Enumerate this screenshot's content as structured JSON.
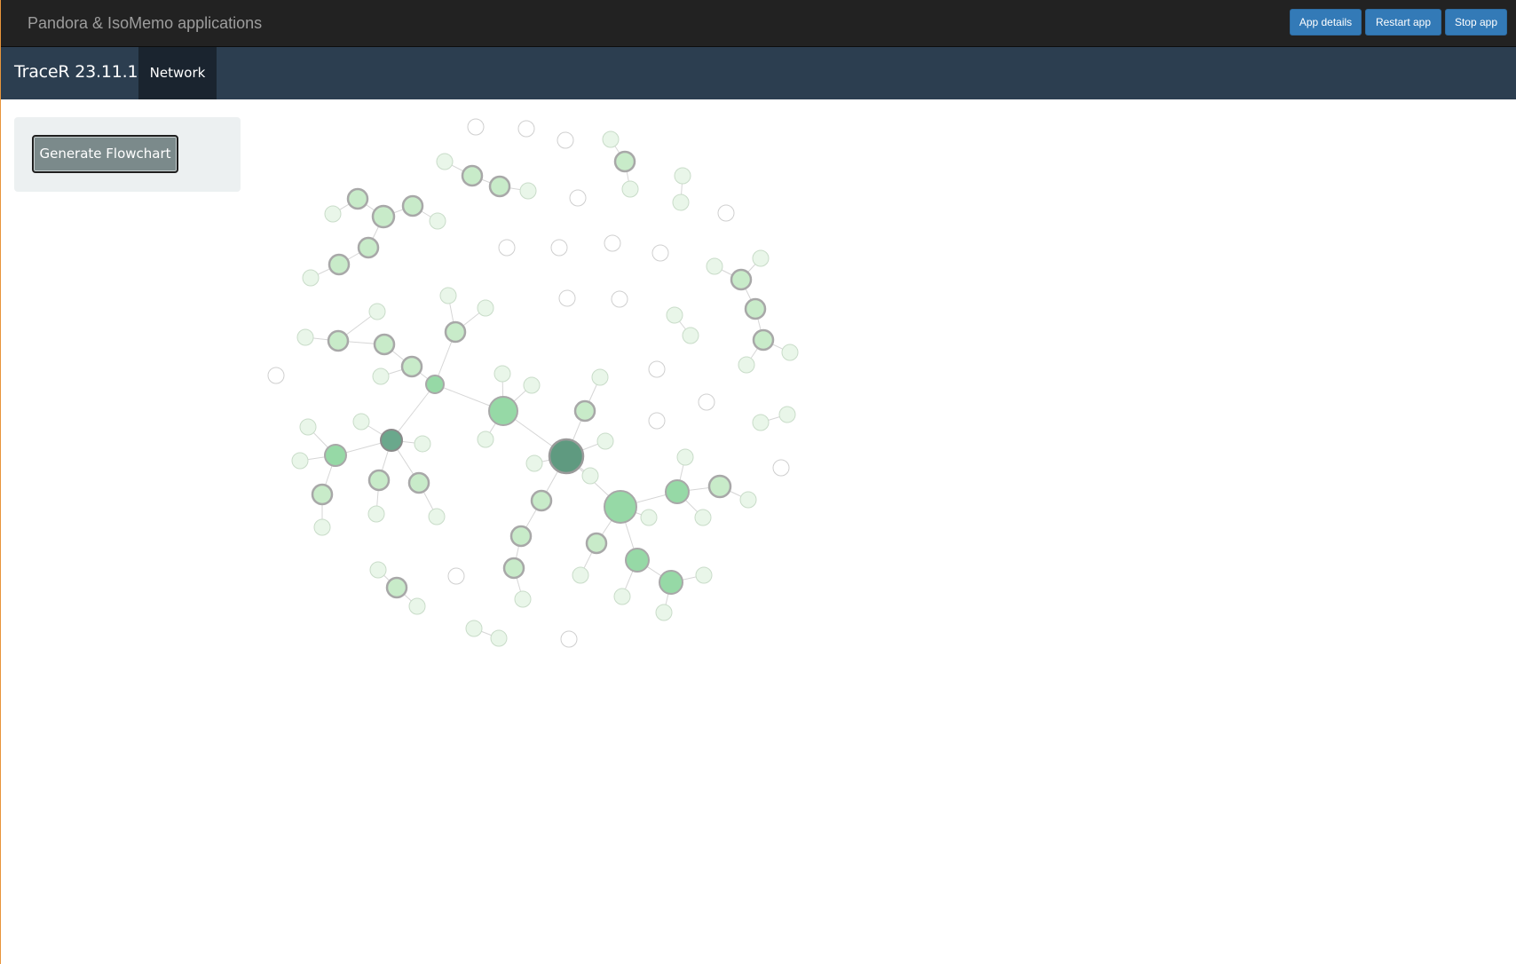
{
  "topbar": {
    "title": "Pandora & IsoMemo applications",
    "buttons": {
      "details": "App details",
      "restart": "Restart app",
      "stop": "Stop app"
    }
  },
  "navbar": {
    "brand": "TraceR 23.11.1",
    "tab": "Network"
  },
  "sidebar": {
    "generate_label": "Generate Flowchart"
  },
  "network": {
    "colors": {
      "edge": "#d6d6d6",
      "node_light": "#e9f6e9",
      "node_mid": "#c8ebc9",
      "node_strong": "#96d9a6",
      "node_dark": "#6aa88c",
      "node_darkest": "#5f9a80",
      "ring": "#a8a8a8",
      "faint_outline": "#cfcfcf"
    }
  }
}
